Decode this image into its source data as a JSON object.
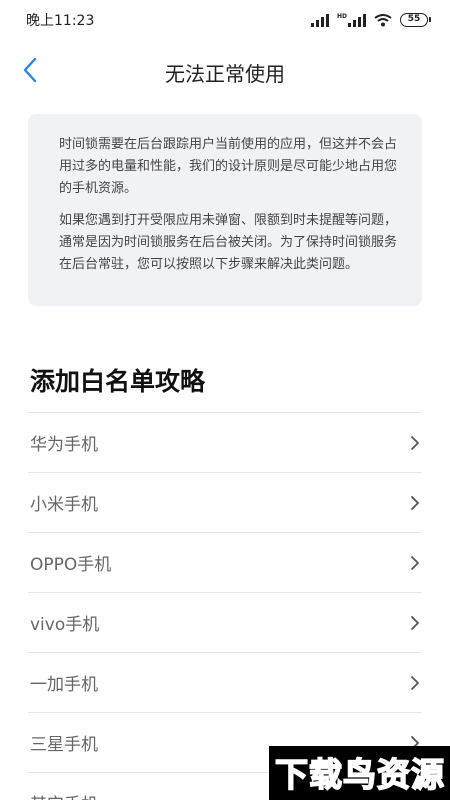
{
  "status": {
    "time": "晚上11:23",
    "battery": "55"
  },
  "header": {
    "title": "无法正常使用"
  },
  "info": {
    "paragraphs": [
      "时间锁需要在后台跟踪用户当前使用的应用，但这并不会占用过多的电量和性能，我们的设计原则是尽可能少地占用您的手机资源。",
      "如果您遇到打开受限应用未弹窗、限额到时未提醒等问题，通常是因为时间锁服务在后台被关闭。为了保持时间锁服务在后台常驻，您可以按照以下步骤来解决此类问题。"
    ]
  },
  "section": {
    "title": "添加白名单攻略",
    "items": [
      {
        "label": "华为手机"
      },
      {
        "label": "小米手机"
      },
      {
        "label": "OPPO手机"
      },
      {
        "label": "vivo手机"
      },
      {
        "label": "一加手机"
      },
      {
        "label": "三星手机"
      },
      {
        "label": "其它手机"
      }
    ]
  },
  "watermark": {
    "text": "下载鸟资源"
  },
  "colors": {
    "card_bg": "#f1f2f6",
    "accent_blue": "#2a84e8",
    "divider": "#e6e6e6"
  }
}
